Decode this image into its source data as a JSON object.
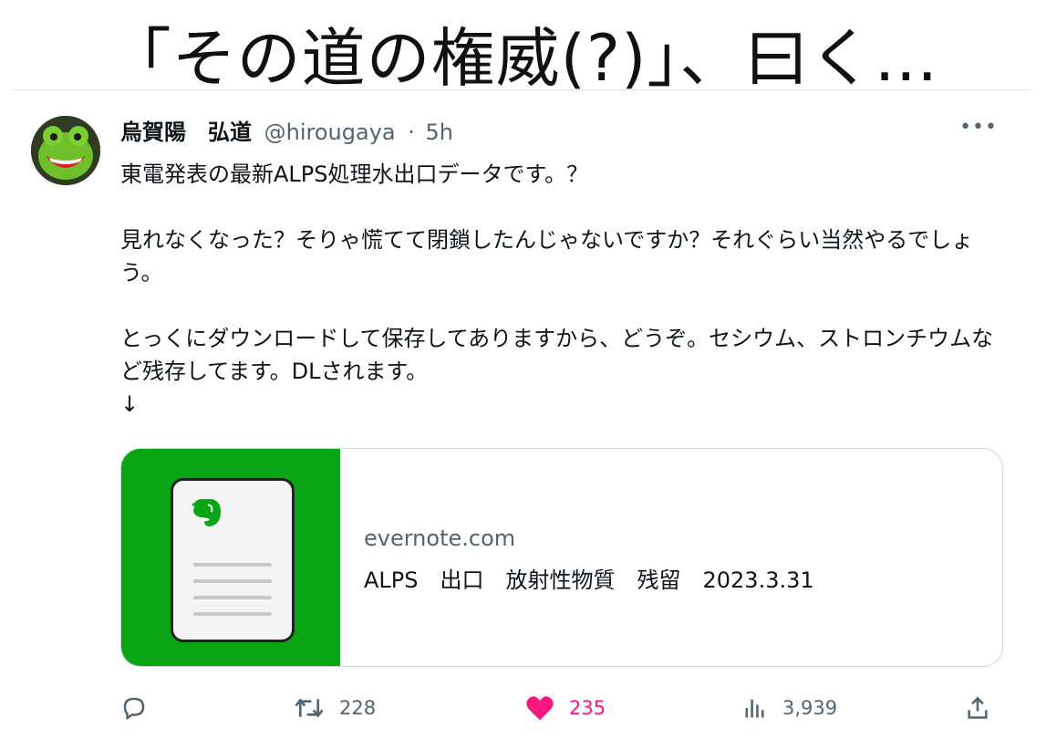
{
  "caption": "「その道の権威(?)」、曰く…",
  "tweet": {
    "author_name": "烏賀陽　弘道",
    "handle": "@hirougaya",
    "separator": "·",
    "time": "5h",
    "more_icon": "•••",
    "paragraphs": [
      "東電発表の最新ALPS処理水出口データです。？",
      "見れなくなった？そりゃ慌てて閉鎖したんじゃないですか？それぐらい当然やるでしょう。",
      "とっくにダウンロードして保存してありますから、どうぞ。セシウム、ストロンチウムなど残存してます。DLされます。\n↓"
    ],
    "card": {
      "domain": "evernote.com",
      "title": "ALPS　出口　放射性物質　残留　2023.3.31",
      "thumb_color": "#0aa514",
      "icon": "evernote-elephant-icon"
    },
    "actions": {
      "reply": {
        "icon": "reply-icon"
      },
      "retweet": {
        "icon": "retweet-icon",
        "count": "228"
      },
      "like": {
        "icon": "heart-icon",
        "count": "235",
        "color": "#f91880",
        "liked": true
      },
      "views": {
        "icon": "views-icon",
        "count": "3,939"
      },
      "share": {
        "icon": "share-icon"
      }
    }
  }
}
